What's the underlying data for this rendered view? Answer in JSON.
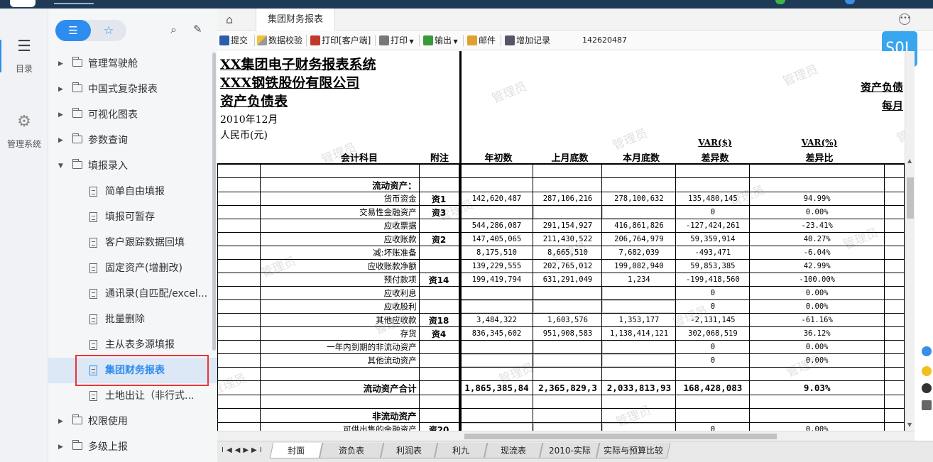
{
  "sidebar": {
    "items": [
      {
        "label": "目录",
        "icon": "list-icon"
      },
      {
        "label": "管理系统",
        "icon": "gear-icon"
      }
    ]
  },
  "tree": {
    "items": [
      {
        "label": "管理驾驶舱",
        "type": "folder",
        "expanded": false
      },
      {
        "label": "中国式复杂报表",
        "type": "folder",
        "expanded": false
      },
      {
        "label": "可视化图表",
        "type": "folder",
        "expanded": false
      },
      {
        "label": "参数查询",
        "type": "folder",
        "expanded": false
      },
      {
        "label": "填报录入",
        "type": "folder",
        "expanded": true
      },
      {
        "label": "简单自由填报",
        "type": "leaf"
      },
      {
        "label": "填报可暂存",
        "type": "leaf"
      },
      {
        "label": "客户跟踪数据回填",
        "type": "leaf"
      },
      {
        "label": "固定资产(增删改)",
        "type": "leaf"
      },
      {
        "label": "通讯录(自匹配/excel...",
        "type": "leaf"
      },
      {
        "label": "批量删除",
        "type": "leaf"
      },
      {
        "label": "主从表多源填报",
        "type": "leaf"
      },
      {
        "label": "集团财务报表",
        "type": "leaf",
        "selected": true
      },
      {
        "label": "土地出让（非行式...",
        "type": "leaf"
      },
      {
        "label": "权限使用",
        "type": "folder",
        "expanded": false
      },
      {
        "label": "多级上报",
        "type": "folder",
        "expanded": false
      }
    ]
  },
  "tabs": {
    "home_icon": "home-icon",
    "active": "集团财务报表"
  },
  "toolbar": {
    "submit": "提交",
    "validate": "数据校验",
    "print_client": "打印[客户端]",
    "print": "打印",
    "export": "输出",
    "mail": "邮件",
    "add_record": "增加记录",
    "value": "142620487"
  },
  "sql_badge": "SQL",
  "report": {
    "system_title": "XX集团电子财务报表系统",
    "company": "XXX钢铁股份有限公司",
    "report_name": "资产负债表",
    "period": "2010年12月",
    "currency": "人民币(元)",
    "right_title": "资产负债",
    "right_freq": "每月",
    "headers": {
      "account": "会计科目",
      "note": "附注",
      "begin": "年初数",
      "last_month": "上月底数",
      "this_month": "本月底数",
      "var_amt_top": "VAR($)",
      "var_amt": "差异数",
      "var_pct_top": "VAR(%)",
      "var_pct": "差异比"
    },
    "rows": [
      {
        "account": "",
        "note": "",
        "begin": "",
        "last": "",
        "this": "",
        "diff": "",
        "pct": ""
      },
      {
        "account": "流动资产：",
        "note": "",
        "begin": "",
        "last": "",
        "this": "",
        "diff": "",
        "pct": "",
        "bold": true
      },
      {
        "account": "货币资金",
        "note": "资1",
        "begin": "142,620,487",
        "last": "287,106,216",
        "this": "278,100,632",
        "diff": "135,480,145",
        "pct": "94.99%"
      },
      {
        "account": "交易性金融资产",
        "note": "资3",
        "begin": "",
        "last": "",
        "this": "",
        "diff": "0",
        "pct": "0.00%"
      },
      {
        "account": "应收票据",
        "note": "",
        "begin": "544,286,087",
        "last": "291,154,927",
        "this": "416,861,826",
        "diff": "-127,424,261",
        "pct": "-23.41%"
      },
      {
        "account": "应收账款",
        "note": "资2",
        "begin": "147,405,065",
        "last": "211,430,522",
        "this": "206,764,979",
        "diff": "59,359,914",
        "pct": "40.27%"
      },
      {
        "account": "减:坏账准备",
        "note": "",
        "begin": "8,175,510",
        "last": "8,665,510",
        "this": "7,682,039",
        "diff": "-493,471",
        "pct": "-6.04%"
      },
      {
        "account": "应收账款净额",
        "note": "",
        "begin": "139,229,555",
        "last": "202,765,012",
        "this": "199,082,940",
        "diff": "59,853,385",
        "pct": "42.99%"
      },
      {
        "account": "预付款项",
        "note": "资14",
        "begin": "199,419,794",
        "last": "631,291,049",
        "this": "1,234",
        "diff": "-199,418,560",
        "pct": "-100.00%"
      },
      {
        "account": "应收利息",
        "note": "",
        "begin": "",
        "last": "",
        "this": "",
        "diff": "0",
        "pct": "0.00%"
      },
      {
        "account": "应收股利",
        "note": "",
        "begin": "",
        "last": "",
        "this": "",
        "diff": "0",
        "pct": "0.00%"
      },
      {
        "account": "其他应收款",
        "note": "资18",
        "begin": "3,484,322",
        "last": "1,603,576",
        "this": "1,353,177",
        "diff": "-2,131,145",
        "pct": "-61.16%"
      },
      {
        "account": "存货",
        "note": "资4",
        "begin": "836,345,602",
        "last": "951,908,583",
        "this": "1,138,414,121",
        "diff": "302,068,519",
        "pct": "36.12%"
      },
      {
        "account": "一年内到期的非流动资产",
        "note": "",
        "begin": "",
        "last": "",
        "this": "",
        "diff": "0",
        "pct": "0.00%"
      },
      {
        "account": "其他流动资产",
        "note": "",
        "begin": "",
        "last": "",
        "this": "",
        "diff": "0",
        "pct": "0.00%"
      },
      {
        "account": "",
        "note": "",
        "begin": "",
        "last": "",
        "this": "",
        "diff": "",
        "pct": ""
      },
      {
        "account": "流动资产合计",
        "note": "",
        "begin": "1,865,385,84",
        "last": "2,365,829,3",
        "this": "2,033,813,93",
        "diff": "168,428,083",
        "pct": "9.03%",
        "bold": true
      },
      {
        "account": "",
        "note": "",
        "begin": "",
        "last": "",
        "this": "",
        "diff": "",
        "pct": ""
      },
      {
        "account": "非流动资产",
        "note": "",
        "begin": "",
        "last": "",
        "this": "",
        "diff": "",
        "pct": "",
        "bold": true
      },
      {
        "account": "可供出售的金融资产",
        "note": "资20",
        "begin": "",
        "last": "",
        "this": "",
        "diff": "0",
        "pct": "0.00%"
      }
    ],
    "watermark": "管理员"
  },
  "sheets": {
    "items": [
      "封面",
      "资负表",
      "利润表",
      "利九",
      "现流表",
      "2010-实际",
      "实际与预算比较"
    ],
    "active": "封面"
  },
  "colors": {
    "accent": "#2d8cf0",
    "topbar": "#1f3a57",
    "selection_outline": "#e33333",
    "sql_badge": "#38a6ee"
  }
}
